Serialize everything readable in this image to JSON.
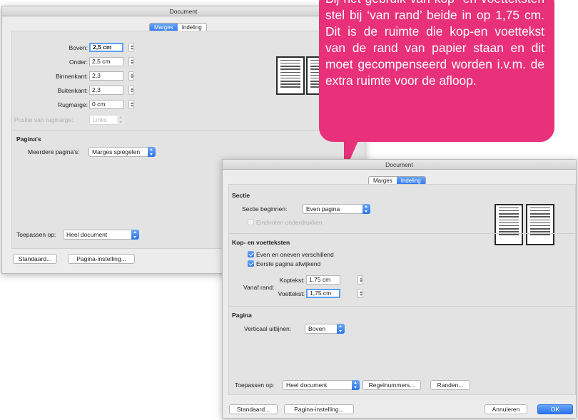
{
  "dialog1": {
    "title": "Document",
    "tabs": [
      {
        "label": "Marges",
        "active": true
      },
      {
        "label": "Indeling",
        "active": false
      }
    ],
    "fields": [
      {
        "label": "Boven:",
        "value": "2,5 cm"
      },
      {
        "label": "Onder:",
        "value": "2,5 cm"
      },
      {
        "label": "Binnenkant:",
        "value": "2,3"
      },
      {
        "label": "Buitenkant:",
        "value": "2,3"
      },
      {
        "label": "Rugmarge:",
        "value": "0 cm"
      }
    ],
    "gutter_position_label": "Positie van rugmarge:",
    "gutter_position_value": "Links",
    "pages_heading": "Pagina's",
    "multiple_pages_label": "Meerdere pagina's:",
    "multiple_pages_value": "Marges spiegelen",
    "apply_label": "Toepassen op:",
    "apply_value": "Heel document",
    "default_button": "Standaard...",
    "page_setup_button": "Pagina-instelling..."
  },
  "callout": {
    "text": "Bij het gebruik van kop- en voetteksten stel bij ‘van rand’ beide in op 1,75 cm. Dit is de ruimte die kop-en voettekst van de rand van papier staan en dit moet gecompenseerd worden i.v.m. de extra ruimte voor de afloop.",
    "color": "#e8317a"
  },
  "dialog2": {
    "title": "Document",
    "tabs": [
      {
        "label": "Marges",
        "active": false
      },
      {
        "label": "Indeling",
        "active": true
      }
    ],
    "section_heading": "Sectie",
    "section_start_label": "Sectie beginnen:",
    "section_start_value": "Even pagina",
    "suppress_endnotes_label": "Eindnoten onderdrukken",
    "header_footer_heading": "Kop- en voetteksten",
    "odd_even_label": "Even en oneven verschillend",
    "first_page_label": "Eerste pagina afwijkend",
    "from_edge_label": "Vanaf rand:",
    "header_label": "Koptekst:",
    "header_value": "1,75 cm",
    "footer_label": "Voettekst:",
    "footer_value": "1,75 cm",
    "page_heading": "Pagina",
    "vertical_align_label": "Verticaal uitlijnen:",
    "vertical_align_value": "Boven",
    "apply_label": "Toepassen op:",
    "apply_value": "Heel document",
    "line_numbers_button": "Regelnummers...",
    "borders_button": "Randen...",
    "default_button": "Standaard...",
    "page_setup_button": "Pagina-instelling...",
    "cancel_button": "Annuleren",
    "ok_button": "OK"
  },
  "colors": {
    "accent_blue": "#2f77ee",
    "callout_pink": "#e8317a"
  }
}
